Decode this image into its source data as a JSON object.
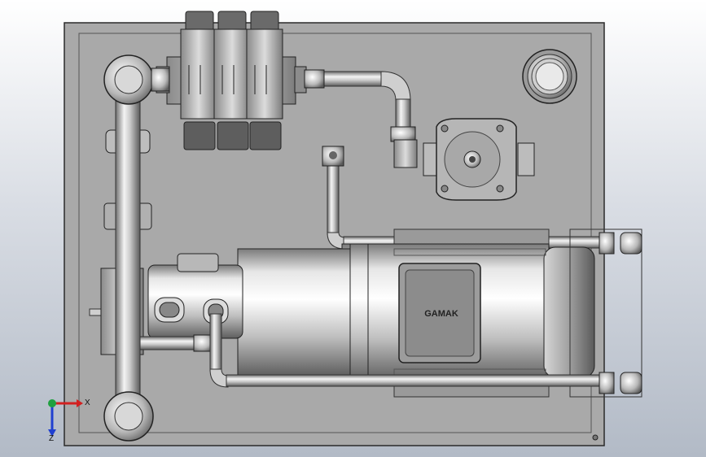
{
  "viewport": {
    "motor_brand": "GAMAK",
    "triad_axes": {
      "x": "X",
      "y": "Y",
      "z": "Z"
    },
    "colors": {
      "background_top": "#ffffff",
      "background_bottom": "#b2bac6",
      "plate": "#a9a9a9",
      "metal_light": "#f2f2f2",
      "metal_dark": "#3c3c3c",
      "axis_x": "#d22020",
      "axis_y": "#20a040",
      "axis_z": "#2040d0"
    }
  }
}
